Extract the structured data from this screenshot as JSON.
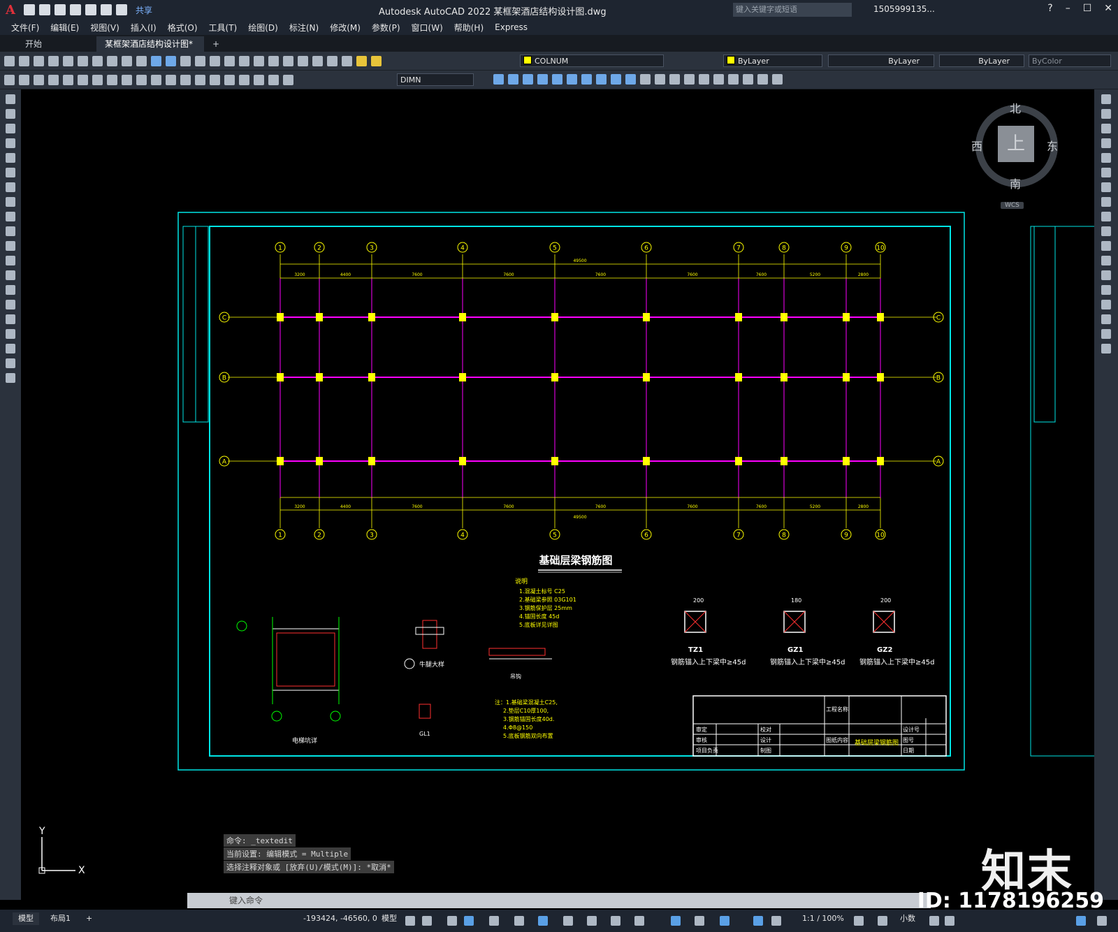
{
  "titlebar": {
    "logo": "A",
    "share": "共享",
    "app_title": "Autodesk AutoCAD 2022    某框架酒店结构设计图.dwg",
    "search_placeholder": "键入关键字或短语",
    "user": "1505999135...",
    "help": "?"
  },
  "menu": [
    "文件(F)",
    "编辑(E)",
    "视图(V)",
    "插入(I)",
    "格式(O)",
    "工具(T)",
    "绘图(D)",
    "标注(N)",
    "修改(M)",
    "参数(P)",
    "窗口(W)",
    "帮助(H)",
    "Express"
  ],
  "tabs": {
    "start": "开始",
    "doc": "某框架酒店结构设计图*",
    "close": "×",
    "add": "+"
  },
  "toolbar1": {
    "layer": "COLNUM",
    "color": "ByLayer",
    "linetype": "ByLayer",
    "lineweight": "ByLayer",
    "plotstyle": "ByColor"
  },
  "toolbar2": {
    "dimstyle": "DIMN"
  },
  "viewcube": {
    "north": "北",
    "south": "南",
    "east": "东",
    "west": "西",
    "top": "上",
    "wcs": "WCS"
  },
  "drawing": {
    "title": "基础层梁钢筋图",
    "axes_numbers": [
      "1",
      "2",
      "3",
      "4",
      "5",
      "6",
      "7",
      "8",
      "9",
      "10"
    ],
    "axes_letters": [
      "C",
      "B",
      "A"
    ],
    "total_dim": "49500",
    "top_dims": [
      "3200",
      "4400",
      "7600",
      "7600",
      "7600",
      "7600",
      "7600",
      "5200",
      "2800"
    ],
    "notes_heading": "说明",
    "notes": [
      "1.混凝土标号 C25",
      "2.基础梁参照 03G101",
      "3.钢筋保护层 25mm",
      "4.锚固长度 45d",
      "5.底板详见详图"
    ],
    "sections": [
      {
        "label": "TZ1",
        "dim": "200",
        "note": "钢筋锚入上下梁中≥45d"
      },
      {
        "label": "GZ1",
        "dim": "180",
        "note": "钢筋锚入上下梁中≥45d"
      },
      {
        "label": "GZ2",
        "dim": "200",
        "note": "钢筋锚入上下梁中≥45d"
      }
    ],
    "detail_labels": [
      "电梯坑详",
      "牛腿大样",
      "吊钩",
      "GL1"
    ],
    "bottom_notes": [
      "注：1.基础梁混凝土C25,",
      "2.垫层C10厚100,",
      "3.钢筋锚固长度40d.",
      "4.Φ8@150",
      "5.底板钢筋双向布置"
    ],
    "title_block": {
      "proj": "工程名称",
      "sheet": "基础层梁钢筋图",
      "cells": [
        "审定",
        "审核",
        "项目负责",
        "校对",
        "设计",
        "制图",
        "图纸内容",
        "设计号",
        "图号",
        "日期"
      ]
    }
  },
  "command": {
    "line1": "命令: _textedit",
    "line2": "当前设置: 编辑模式 = Multiple",
    "line3": "选择注释对象或 [放弃(U)/模式(M)]: *取消*",
    "input_placeholder": "键入命令"
  },
  "statusbar": {
    "model_tab": "模型",
    "layout_tab": "布局1",
    "add": "+",
    "coords": "-193424, -46560, 0",
    "mode": "模型",
    "scale": "1:1 / 100%",
    "units": "小数"
  },
  "watermark": {
    "brand": "知末",
    "id": "ID: 1178196259"
  },
  "colors": {
    "accent": "#00e5e5",
    "yellow": "#ffff00",
    "magenta": "#ff00ff",
    "green": "#00ff00",
    "white": "#ffffff"
  }
}
